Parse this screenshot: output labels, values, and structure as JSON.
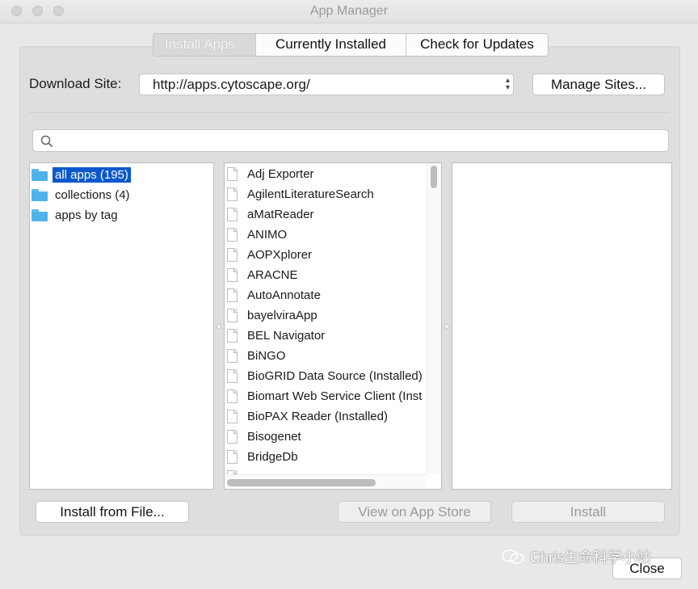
{
  "window": {
    "title": "App Manager"
  },
  "tabs": [
    {
      "label": "Install Apps",
      "selected": true
    },
    {
      "label": "Currently Installed",
      "selected": false
    },
    {
      "label": "Check for Updates",
      "selected": false
    }
  ],
  "download": {
    "label": "Download Site:",
    "site": "http://apps.cytoscape.org/",
    "manage_label": "Manage Sites..."
  },
  "search": {
    "value": "",
    "placeholder": ""
  },
  "tree": [
    {
      "label": "all apps (195)",
      "selected": true
    },
    {
      "label": "collections (4)",
      "selected": false
    },
    {
      "label": "apps by tag",
      "selected": false
    }
  ],
  "apps": [
    "Adj Exporter",
    "AgilentLiteratureSearch",
    "aMatReader",
    "ANIMO",
    "AOPXplorer",
    "ARACNE",
    "AutoAnnotate",
    "bayelviraApp",
    "BEL Navigator",
    "BiNGO",
    "BioGRID Data Source (Installed)",
    "Biomart Web Service Client (Inst",
    "BioPAX Reader (Installed)",
    "Bisogenet",
    "BridgeDb"
  ],
  "buttons": {
    "install_file": "Install from File...",
    "view_store": "View on App Store",
    "install": "Install",
    "close": "Close"
  },
  "watermark": "Chris生命科学小站",
  "colors": {
    "selection": "#0a57d0",
    "folder": "#4fb2ec"
  }
}
